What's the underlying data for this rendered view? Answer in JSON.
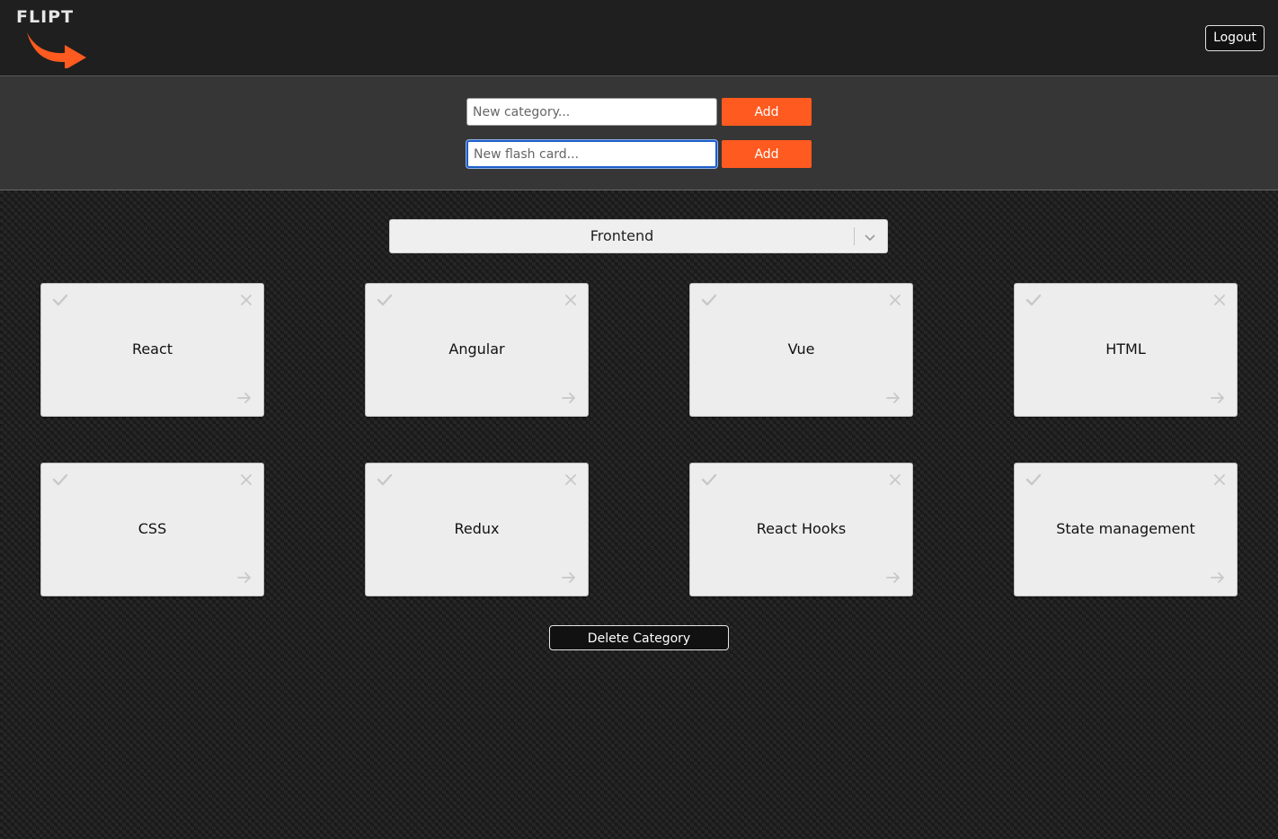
{
  "header": {
    "brand": "FLIPT",
    "logout_label": "Logout"
  },
  "forms": {
    "category": {
      "placeholder": "New category...",
      "value": "",
      "add_label": "Add"
    },
    "flashcard": {
      "placeholder": "New flash card...",
      "value": "",
      "add_label": "Add"
    }
  },
  "category_select": {
    "selected": "Frontend"
  },
  "cards": [
    {
      "title": "React"
    },
    {
      "title": "Angular"
    },
    {
      "title": "Vue"
    },
    {
      "title": "HTML"
    },
    {
      "title": "CSS"
    },
    {
      "title": "Redux"
    },
    {
      "title": "React Hooks"
    },
    {
      "title": "State management"
    }
  ],
  "card_icons": {
    "check": "check-icon",
    "close": "close-icon",
    "arrow": "arrow-right-icon"
  },
  "delete_label": "Delete Category",
  "colors": {
    "accent": "#ff5a1f",
    "header_bg": "#1f1f1f",
    "panel_bg": "#363636",
    "card_bg": "#ededed",
    "icon_muted": "#c8c8c8"
  }
}
